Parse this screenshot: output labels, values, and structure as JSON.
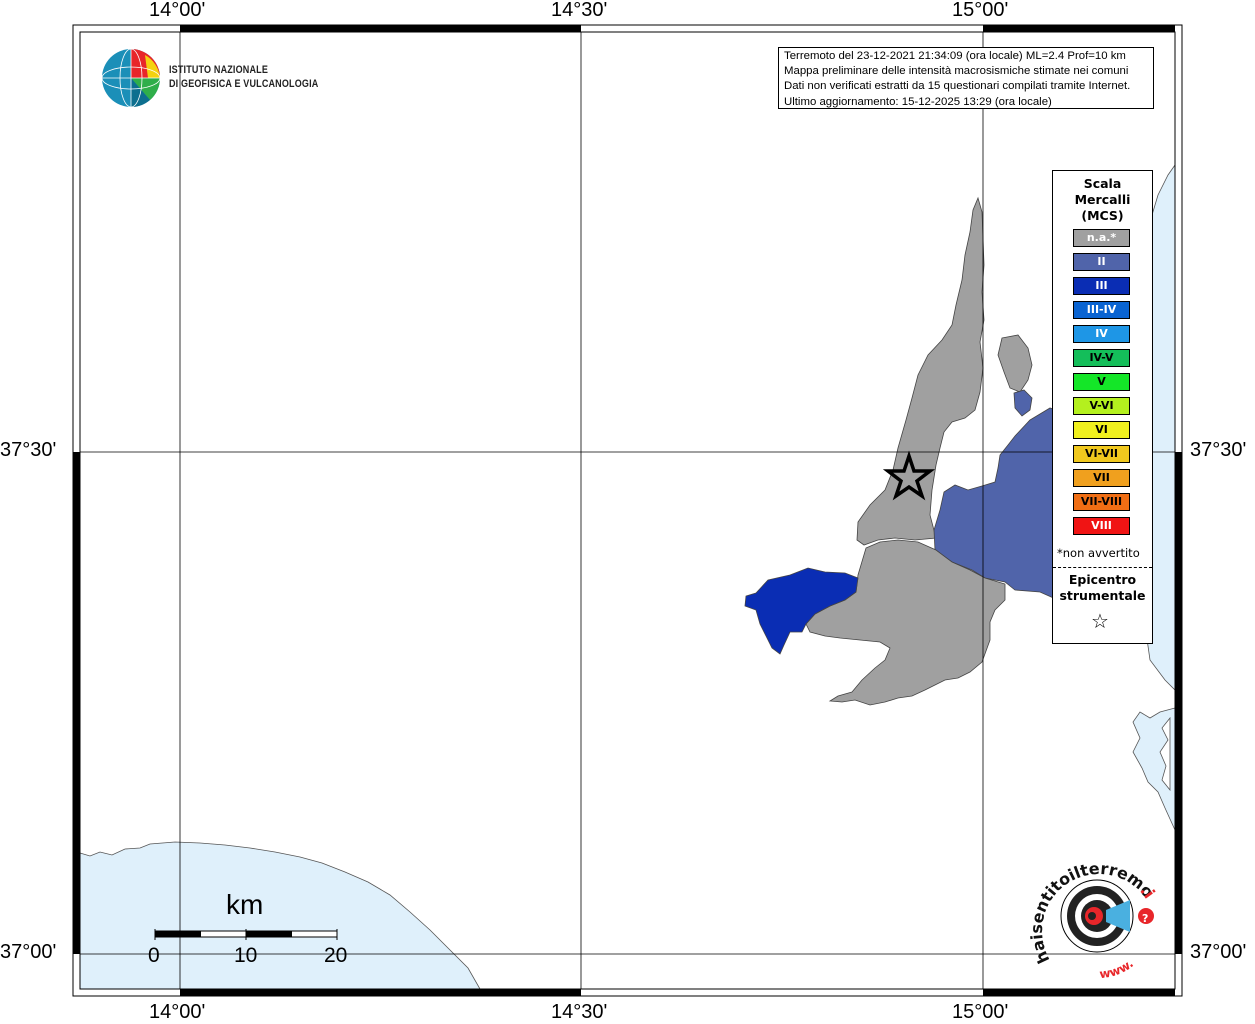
{
  "info": {
    "line1": "Terremoto del 23-12-2021 21:34:09 (ora locale) ML=2.4 Prof=10 km",
    "line2": "Mappa preliminare delle intensità macrosismiche stimate nei comuni",
    "line3": "Dati non verificati estratti da 15 questionari compilati tramite Internet.",
    "line4": "Ultimo aggiornamento: 15-12-2025 13:29 (ora locale)"
  },
  "logo": {
    "line1": "ISTITUTO NAZIONALE",
    "line2": "DI GEOFISICA E VULCANOLOGIA"
  },
  "axes": {
    "lon_labels": [
      "14°00'",
      "14°30'",
      "15°00'"
    ],
    "lat_labels": [
      "37°30'",
      "37°00'"
    ]
  },
  "legend": {
    "title_line1": "Scala",
    "title_line2": "Mercalli",
    "title_line3": "(MCS)",
    "items": [
      {
        "label": "n.a.*",
        "color": "#a0a0a0"
      },
      {
        "label": "II",
        "color": "#5064aa"
      },
      {
        "label": "III",
        "color": "#0a2db4"
      },
      {
        "label": "III-IV",
        "color": "#0a64d2"
      },
      {
        "label": "IV",
        "color": "#1e96e6"
      },
      {
        "label": "IV-V",
        "color": "#14be5a"
      },
      {
        "label": "V",
        "color": "#14e628"
      },
      {
        "label": "V-VI",
        "color": "#b4f01e"
      },
      {
        "label": "VI",
        "color": "#f0f01e"
      },
      {
        "label": "VI-VII",
        "color": "#f0c81e"
      },
      {
        "label": "VII",
        "color": "#f0a01e"
      },
      {
        "label": "VII-VIII",
        "color": "#f06e14"
      },
      {
        "label": "VIII",
        "color": "#f01414"
      }
    ],
    "note": "*non avvertito",
    "epicenter_line1": "Epicentro",
    "epicenter_line2": "strumentale",
    "epicenter_symbol": "☆"
  },
  "scalebar": {
    "unit": "km",
    "ticks": [
      "0",
      "10",
      "20"
    ]
  },
  "haisentito": {
    "text_main": "haisentitoilterremoto",
    "text_it": ".it",
    "text_www": "www.",
    "question_mark": "?"
  },
  "colors": {
    "sea": "#dff0fb",
    "land_na": "#a0a0a0",
    "intensity_II": "#5064aa",
    "intensity_III": "#0a2db4"
  }
}
